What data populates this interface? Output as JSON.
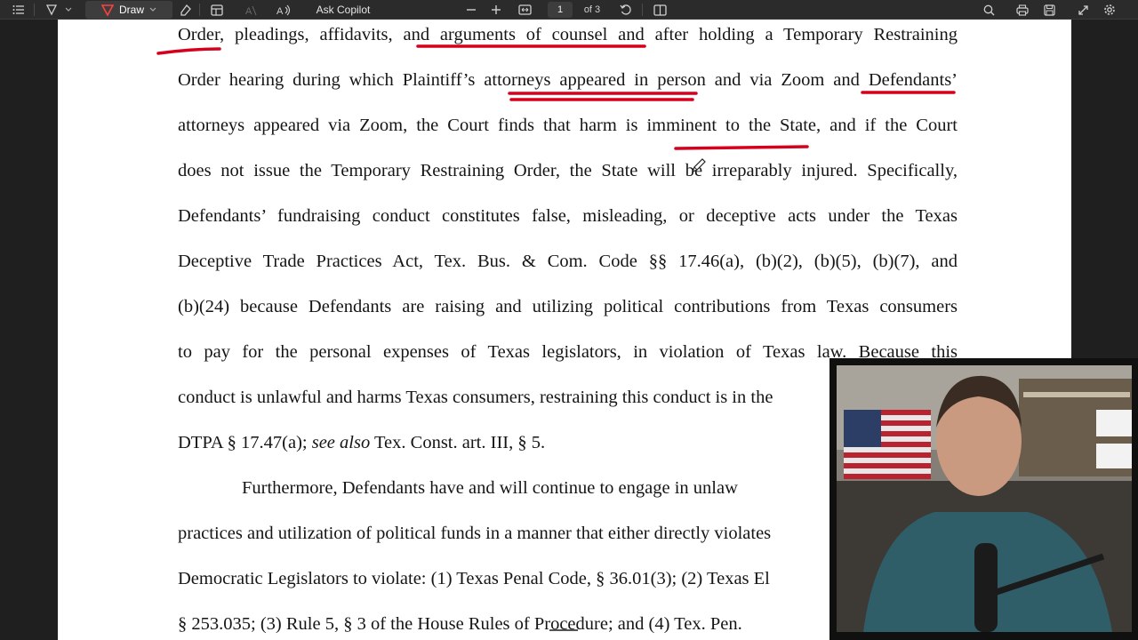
{
  "toolbar": {
    "draw_label": "Draw",
    "copilot_label": "Ask Copilot",
    "page_current": "1",
    "page_total": "of 3",
    "icons": [
      "contents-icon",
      "highlight-icon",
      "chevron-down-icon",
      "pen-icon",
      "eraser-icon",
      "layout-icon",
      "text-icon",
      "read-aloud-icon",
      "zoom-out-icon",
      "zoom-in-icon",
      "fit-page-icon",
      "rotate-icon",
      "two-page-icon",
      "search-icon",
      "print-icon",
      "save-icon",
      "expand-icon",
      "settings-icon"
    ]
  },
  "document": {
    "lines": [
      "Order, pleadings, affidavits, and arguments of counsel and after holding a Temporary Restraining",
      "Order hearing during which Plaintiff’s attorneys appeared in person and via Zoom and Defendants’",
      "attorneys appeared via Zoom, the Court finds that harm is imminent to the State, and if the Court",
      "does not issue the Temporary Restraining Order, the State will be irreparably injured. Specifically,",
      "Defendants’ fundraising conduct constitutes false, misleading, or deceptive acts under the Texas",
      "Deceptive Trade Practices Act, Tex. Bus. & Com. Code §§ 17.46(a), (b)(2), (b)(5), (b)(7), and",
      "(b)(24) because Defendants are raising and utilizing political contributions from Texas consumers",
      "to pay for the personal expenses of Texas legislators, in violation of Texas law. Because this",
      "conduct is unlawful and harms Texas consumers, restraining this conduct is in the",
      "practices and utilization of political funds in a manner that either directly violates",
      "Democratic Legislators to violate: (1) Texas Penal Code, § 36.01(3); (2) Texas El",
      "§ 253.035; (3) Rule 5, § 3 of the House Rules of Procedure; and (4) Tex. Pen."
    ],
    "dtpa_line": {
      "before": "DTPA § 17.47(a); ",
      "italic": "see also",
      "after": " Tex. Const. art. III, § 5."
    },
    "para_start": "Furthermore, Defendants have and will continue to engage in unlaw"
  },
  "colors": {
    "ink": "#d6001c",
    "toolbar": "#2b2b2b",
    "page": "#ffffff"
  }
}
